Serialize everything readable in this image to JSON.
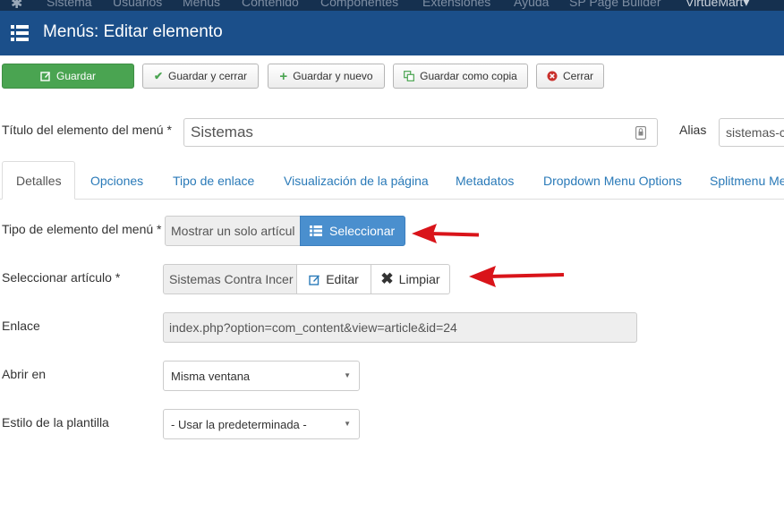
{
  "top_nav": {
    "items": [
      "Sistema",
      "Usuarios",
      "Menús",
      "Contenido",
      "Componentes",
      "Extensiones",
      "Ayuda",
      "SP Page Builder",
      "VirtueMart"
    ]
  },
  "header": {
    "title": "Menús: Editar elemento"
  },
  "toolbar": {
    "save": "Guardar",
    "save_close": "Guardar y cerrar",
    "save_new": "Guardar y nuevo",
    "save_copy": "Guardar como copia",
    "close": "Cerrar"
  },
  "title_field": {
    "label": "Título del elemento del menú *",
    "value": "Sistemas"
  },
  "alias_field": {
    "label": "Alias",
    "value": "sistemas-c"
  },
  "tabs": [
    {
      "label": "Detalles",
      "active": true
    },
    {
      "label": "Opciones"
    },
    {
      "label": "Tipo de enlace"
    },
    {
      "label": "Visualización de la página"
    },
    {
      "label": "Metadatos"
    },
    {
      "label": "Dropdown Menu Options"
    },
    {
      "label": "Splitmenu Me"
    }
  ],
  "menu_type": {
    "label": "Tipo de elemento del menú *",
    "value": "Mostrar un solo artícul",
    "select_button": "Seleccionar"
  },
  "article": {
    "label": "Seleccionar artículo *",
    "value": "Sistemas Contra Incer",
    "edit_button": "Editar",
    "clear_button": "Limpiar"
  },
  "link": {
    "label": "Enlace",
    "value": "index.php?option=com_content&view=article&id=24"
  },
  "open_in": {
    "label": "Abrir en",
    "value": "Misma ventana"
  },
  "template_style": {
    "label": "Estilo de la plantilla",
    "value": "- Usar la predeterminada -"
  },
  "colors": {
    "header_bg": "#1b4f8a",
    "success": "#4aa451",
    "primary": "#4a8fce",
    "arrow": "#d9141a"
  }
}
